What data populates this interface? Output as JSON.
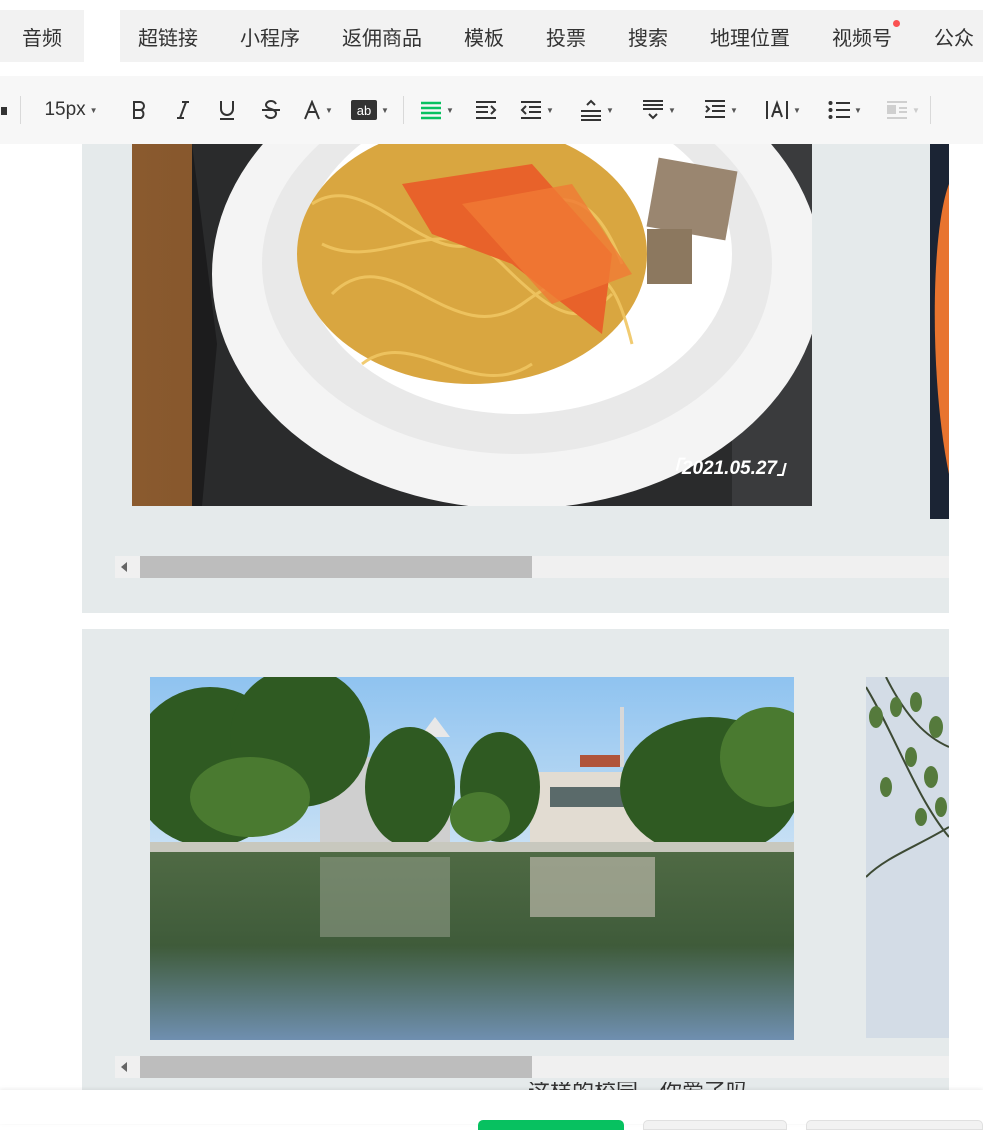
{
  "tabs": {
    "first": "音频",
    "items": [
      {
        "label": "超链接",
        "dot": false
      },
      {
        "label": "小程序",
        "dot": false
      },
      {
        "label": "返佣商品",
        "dot": false
      },
      {
        "label": "模板",
        "dot": false
      },
      {
        "label": "投票",
        "dot": false
      },
      {
        "label": "搜索",
        "dot": false
      },
      {
        "label": "地理位置",
        "dot": false
      },
      {
        "label": "视频号",
        "dot": true
      },
      {
        "label": "公众",
        "dot": false
      }
    ]
  },
  "toolbar": {
    "font_size": "15px",
    "accent_color": "#07c160"
  },
  "content": {
    "photo1_date": "「2021.05.27」",
    "partial_caption": "这样的校园，你爱了吗"
  },
  "colors": {
    "panel_bg": "#e5eaeb",
    "primary_button": "#07c160"
  }
}
